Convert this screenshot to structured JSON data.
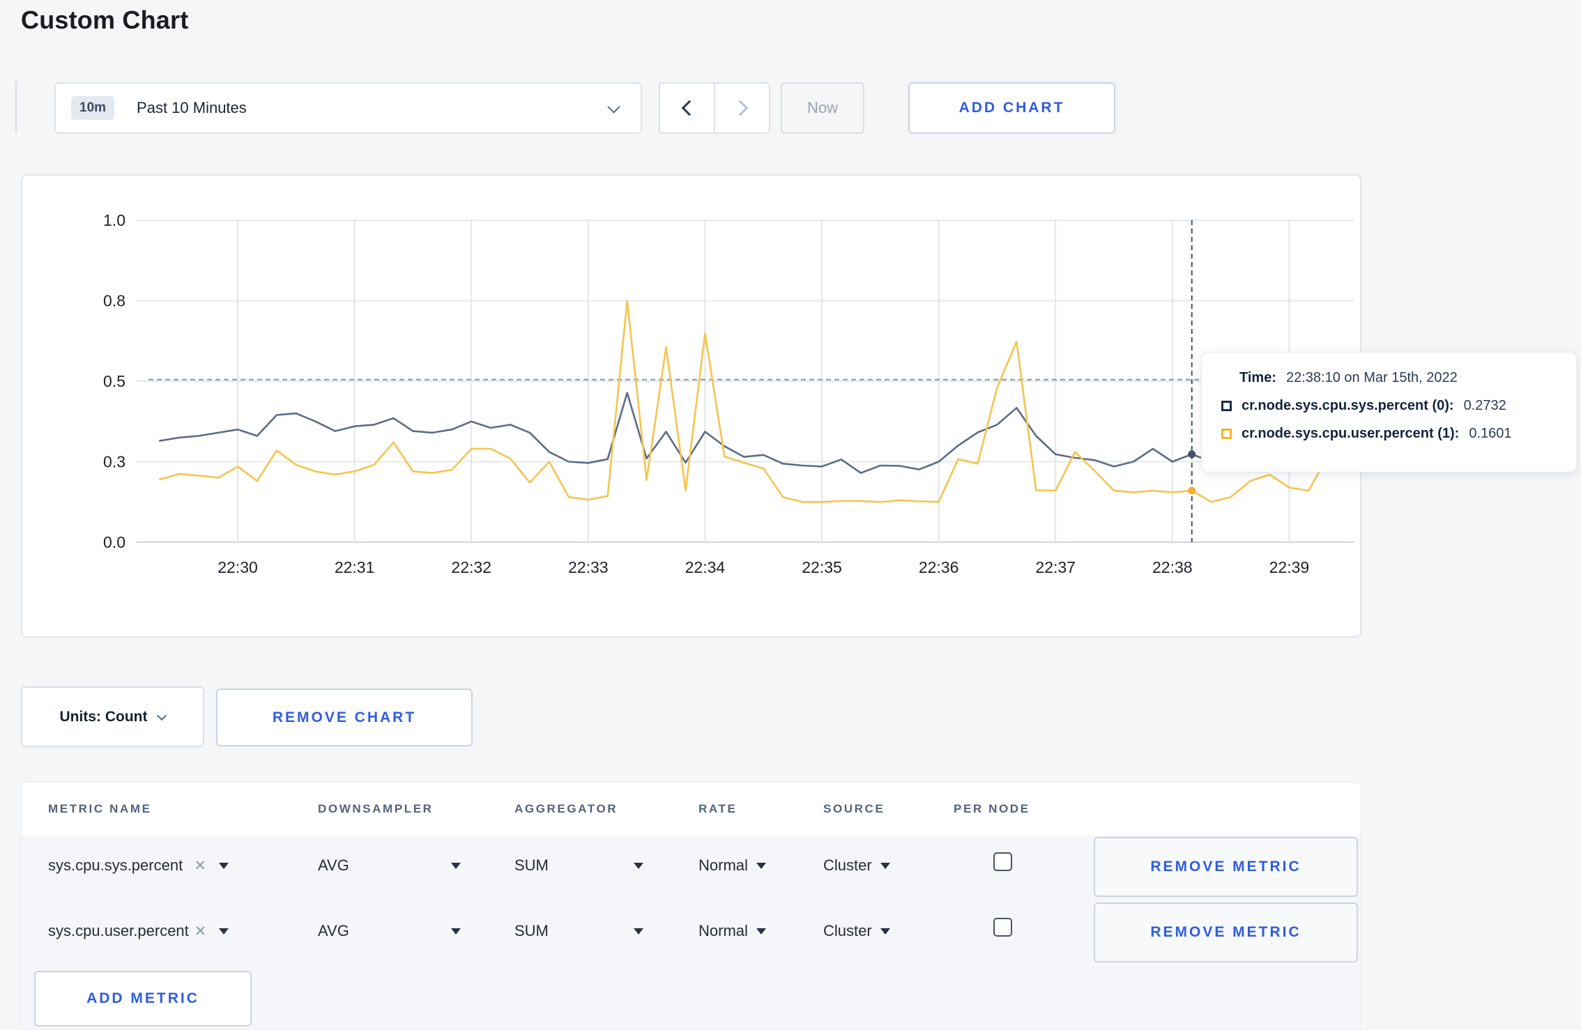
{
  "page": {
    "title": "Custom Chart",
    "background": "#f4f6f8",
    "accent_blue": "#2f5ce0"
  },
  "toolbar": {
    "range_badge": "10m",
    "range_label": "Past 10 Minutes",
    "now_label": "Now",
    "add_chart_label": "ADD CHART"
  },
  "tooltip": {
    "time_label": "Time:",
    "time_value": "22:38:10 on Mar 15th, 2022",
    "rows": [
      {
        "label": "cr.node.sys.cpu.sys.percent (0):",
        "value": "0.2732",
        "color": "#1b2c4f"
      },
      {
        "label": "cr.node.sys.cpu.user.percent (1):",
        "value": "0.1601",
        "color": "#f0b429"
      }
    ]
  },
  "controls": {
    "units_label": "Units: Count",
    "remove_chart_label": "REMOVE CHART"
  },
  "metrics_table": {
    "headers": [
      "METRIC NAME",
      "DOWNSAMPLER",
      "AGGREGATOR",
      "RATE",
      "SOURCE",
      "PER NODE"
    ],
    "rows": [
      {
        "name": "sys.cpu.sys.percent",
        "remove_symbol": "✕",
        "downsampler": "AVG",
        "aggregator": "SUM",
        "rate": "Normal",
        "source": "Cluster",
        "per_node_checked": false,
        "remove_label": "REMOVE METRIC"
      },
      {
        "name": "sys.cpu.user.percent",
        "remove_symbol": "✕",
        "downsampler": "AVG",
        "aggregator": "SUM",
        "rate": "Normal",
        "source": "Cluster",
        "per_node_checked": false,
        "remove_label": "REMOVE METRIC"
      }
    ],
    "add_metric_label": "ADD METRIC"
  },
  "chart_data": {
    "type": "line",
    "title": "",
    "x_start_label": "22:29:20",
    "x_interval_seconds": 10,
    "x_tick_labels": [
      "22:30",
      "22:31",
      "22:32",
      "22:33",
      "22:34",
      "22:35",
      "22:36",
      "22:37",
      "22:38",
      "22:39"
    ],
    "y_ticks": [
      {
        "label": "0.0",
        "value": 0
      },
      {
        "label": "0.3",
        "value": 0.25
      },
      {
        "label": "0.5",
        "value": 0.5
      },
      {
        "label": "0.8",
        "value": 0.75
      },
      {
        "label": "1.0",
        "value": 1
      }
    ],
    "ylim": [
      0,
      1
    ],
    "grid": true,
    "guideline_value": 0.505,
    "crosshair_index": 53,
    "crosshair_time": "22:38:10",
    "series": [
      {
        "name": "cr.node.sys.cpu.sys.percent",
        "color": "#5b6c87",
        "dot_color": "#44536e",
        "values": [
          0.315,
          0.325,
          0.33,
          0.34,
          0.35,
          0.33,
          0.395,
          0.4,
          0.375,
          0.345,
          0.36,
          0.365,
          0.385,
          0.345,
          0.34,
          0.35,
          0.375,
          0.355,
          0.365,
          0.34,
          0.28,
          0.25,
          0.246,
          0.258,
          0.464,
          0.26,
          0.343,
          0.247,
          0.343,
          0.298,
          0.265,
          0.271,
          0.244,
          0.238,
          0.235,
          0.257,
          0.215,
          0.238,
          0.237,
          0.226,
          0.25,
          0.3,
          0.341,
          0.365,
          0.417,
          0.33,
          0.273,
          0.262,
          0.255,
          0.235,
          0.25,
          0.29,
          0.25,
          0.2732,
          0.25,
          0.26,
          0.27,
          0.28,
          0.27,
          0.3,
          0.31
        ]
      },
      {
        "name": "cr.node.sys.cpu.user.percent",
        "color": "#f6c44f",
        "dot_color": "#f0b02f",
        "values": [
          0.195,
          0.212,
          0.207,
          0.2,
          0.235,
          0.19,
          0.285,
          0.24,
          0.22,
          0.21,
          0.22,
          0.24,
          0.31,
          0.22,
          0.215,
          0.225,
          0.29,
          0.29,
          0.26,
          0.185,
          0.25,
          0.14,
          0.132,
          0.143,
          0.75,
          0.193,
          0.606,
          0.161,
          0.648,
          0.266,
          0.247,
          0.229,
          0.14,
          0.125,
          0.125,
          0.128,
          0.128,
          0.125,
          0.13,
          0.127,
          0.125,
          0.258,
          0.244,
          0.48,
          0.623,
          0.161,
          0.16,
          0.28,
          0.222,
          0.16,
          0.155,
          0.16,
          0.155,
          0.1601,
          0.125,
          0.14,
          0.19,
          0.21,
          0.17,
          0.16,
          0.27
        ]
      }
    ]
  }
}
